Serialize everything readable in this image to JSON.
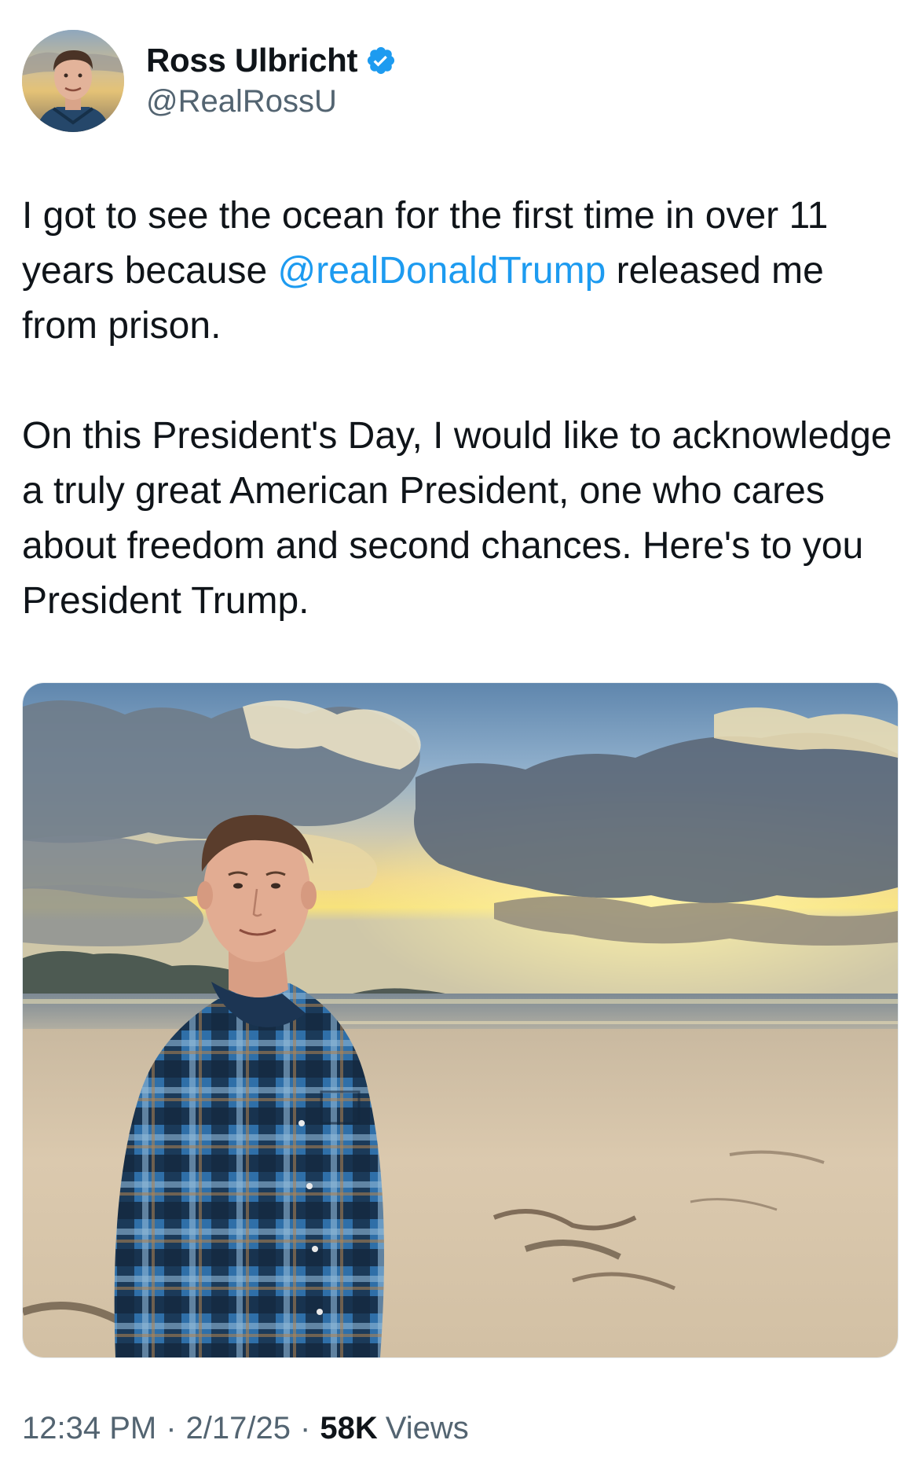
{
  "author": {
    "display_name": "Ross Ulbricht",
    "handle": "@RealRossU",
    "verified": true,
    "avatar_icon": "profile-photo",
    "verified_icon": "verified-badge-icon"
  },
  "tweet": {
    "paragraph1": {
      "before": "I got to see the ocean for the first time in over 11 years because ",
      "mention": "@realDonaldTrump",
      "after": " released me from prison."
    },
    "paragraph2": "On this President's Day, I would like to acknowledge a truly great American President, one who cares about freedom and second chances. Here's to you President Trump."
  },
  "media": {
    "kind": "photo",
    "scene": "beach-sunset-portrait"
  },
  "meta": {
    "time": "12:34 PM",
    "separator": "·",
    "date": "2/17/25",
    "views_count": "58K",
    "views_label": "Views"
  },
  "colors": {
    "text": "#0f1419",
    "secondary": "#536471",
    "link": "#1d9bf0",
    "verified": "#1d9bf0"
  }
}
